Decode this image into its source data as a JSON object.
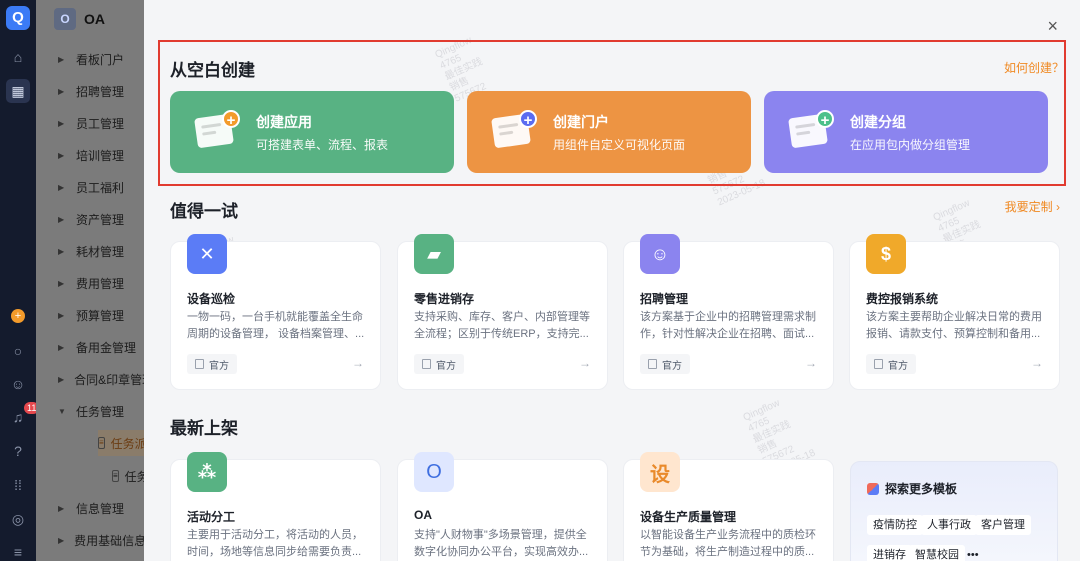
{
  "rail": {
    "logo": "Q",
    "notification_count": "11"
  },
  "nav": {
    "app_icon": "O",
    "app_title": "OA",
    "items": [
      {
        "label": "看板门户"
      },
      {
        "label": "招聘管理"
      },
      {
        "label": "员工管理"
      },
      {
        "label": "培训管理"
      },
      {
        "label": "员工福利"
      },
      {
        "label": "资产管理"
      },
      {
        "label": "耗材管理"
      },
      {
        "label": "费用管理"
      },
      {
        "label": "预算管理"
      },
      {
        "label": "备用金管理"
      },
      {
        "label": "合同&印章管理"
      },
      {
        "label": "任务管理"
      }
    ],
    "sub_items": [
      {
        "label": "任务派发"
      },
      {
        "label": "任务进度"
      }
    ],
    "bottom_items": [
      {
        "label": "信息管理"
      },
      {
        "label": "费用基础信息"
      }
    ]
  },
  "panel": {
    "close_label": "×",
    "blank_section_title": "从空白创建",
    "how_to_create": "如何创建？",
    "create_cards": [
      {
        "title": "创建应用",
        "subtitle": "可搭建表单、流程、报表",
        "color": "#58b283"
      },
      {
        "title": "创建门户",
        "subtitle": "用组件自定义可视化页面",
        "color": "#ed9443"
      },
      {
        "title": "创建分组",
        "subtitle": "在应用包内做分组管理",
        "color": "#8b84ef"
      }
    ],
    "try_section_title": "值得一试",
    "customize_link": "我要定制 ›",
    "try_cards": [
      {
        "name": "设备巡检",
        "desc": "一物一码，一台手机就能覆盖全生命周期的设备管理， 设备档案管理、...",
        "tag": "官方",
        "icon_color": "#5b7cf6"
      },
      {
        "name": "零售进销存",
        "desc": "支持采购、库存、客户、内部管理等全流程；区别于传统ERP，支持完...",
        "tag": "官方",
        "icon_color": "#58b283"
      },
      {
        "name": "招聘管理",
        "desc": "该方案基于企业中的招聘管理需求制作，针对性解决企业在招聘、面试...",
        "tag": "官方",
        "icon_color": "#8b84ef"
      },
      {
        "name": "费控报销系统",
        "desc": "该方案主要帮助企业解决日常的费用报销、请款支付、预算控制和备用...",
        "tag": "官方",
        "icon_color": "#f0a92a"
      }
    ],
    "new_section_title": "最新上架",
    "new_cards": [
      {
        "name": "活动分工",
        "desc": "主要用于活动分工，将活动的人员，时间，场地等信息同步给需要负责...",
        "icon_color": "#58b283",
        "icon_glyph": ""
      },
      {
        "name": "OA",
        "desc": "支持\"人财物事\"多场景管理，提供全数字化协同办公平台，实现高效办...",
        "icon_color": "#dfe7ff",
        "icon_glyph": "O"
      },
      {
        "name": "设备生产质量管理",
        "desc": "以智能设备生产业务流程中的质检环节为基础，将生产制造过程中的质...",
        "icon_color": "#ffe6cf",
        "icon_glyph": "设"
      }
    ],
    "explore": {
      "title": "探索更多模板",
      "chips": [
        "疫情防控",
        "人事行政",
        "客户管理",
        "进销存",
        "智慧校园",
        "•••"
      ]
    }
  }
}
